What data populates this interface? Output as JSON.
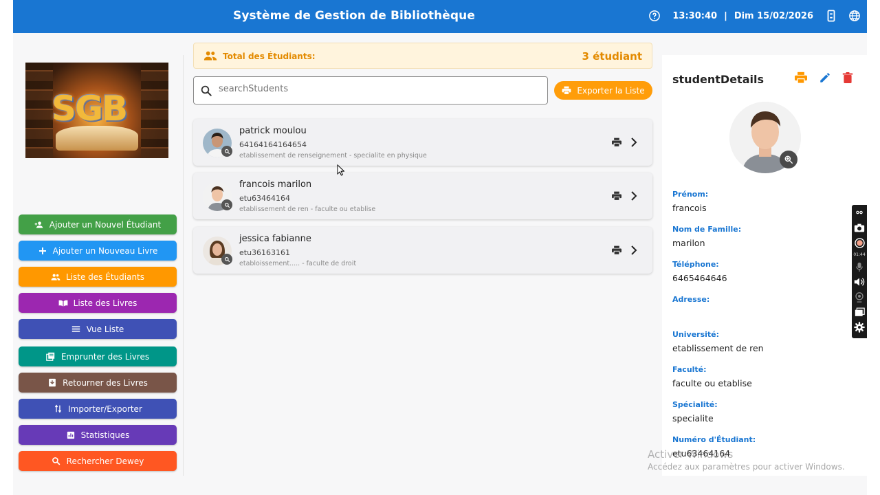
{
  "header": {
    "title": "Système de Gestion de Bibliothèque",
    "time": "13:30:40",
    "separator": "|",
    "date": "Dim 15/02/2026"
  },
  "sidebar": {
    "logo_text": "SGB",
    "buttons": [
      {
        "label": "Ajouter un Nouvel Étudiant",
        "color": "#43a047",
        "icon": "person-add-icon"
      },
      {
        "label": "Ajouter un Nouveau Livre",
        "color": "#2196f3",
        "icon": "plus-icon"
      },
      {
        "label": "Liste des Étudiants",
        "color": "#ff9800",
        "icon": "group-icon"
      },
      {
        "label": "Liste des Livres",
        "color": "#9c27b0",
        "icon": "book-open-icon"
      },
      {
        "label": "Vue Liste",
        "color": "#3f51b5",
        "icon": "list-icon"
      },
      {
        "label": "Emprunter des Livres",
        "color": "#009688",
        "icon": "library-icon"
      },
      {
        "label": "Retourner des Livres",
        "color": "#795548",
        "icon": "return-icon"
      },
      {
        "label": "Importer/Exporter",
        "color": "#3f51b5",
        "icon": "import-export-icon"
      },
      {
        "label": "Statistiques",
        "color": "#673ab7",
        "icon": "chart-icon"
      },
      {
        "label": "Rechercher Dewey",
        "color": "#ff5722",
        "icon": "search-icon"
      }
    ]
  },
  "main": {
    "total_label": "Total des Étudiants:",
    "total_count": "3 étudiant",
    "search_placeholder": "searchStudents",
    "export_label": "Exporter la Liste",
    "students": [
      {
        "name": "patrick moulou",
        "number": "64164164164654",
        "meta": "etablissement de renseignement - specialite en physique"
      },
      {
        "name": "francois marilon",
        "number": "etu63464164",
        "meta": "etablissement de ren - faculte ou etablise"
      },
      {
        "name": "jessica fabianne",
        "number": "etu36163161",
        "meta": "etabloissement..... - faculte de droit"
      }
    ]
  },
  "details": {
    "title": "studentDetails",
    "fields": [
      {
        "label": "Prénom:",
        "value": "francois"
      },
      {
        "label": "Nom de Famille:",
        "value": "marilon"
      },
      {
        "label": "Téléphone:",
        "value": "6465464646"
      },
      {
        "label": "Adresse:",
        "value": ""
      },
      {
        "label": "Université:",
        "value": "etablissement de ren"
      },
      {
        "label": "Faculté:",
        "value": "faculte ou etablise"
      },
      {
        "label": "Spécialité:",
        "value": "specialite"
      },
      {
        "label": "Numéro d'Étudiant:",
        "value": "etu63464164"
      }
    ]
  },
  "recorder": {
    "time": "01:44"
  },
  "watermark": {
    "line1": "Activer Windows",
    "line2": "Accédez aux paramètres pour activer Windows."
  },
  "colors": {
    "accent": "#1976d2",
    "orange": "#ff9d0a",
    "danger": "#e53935"
  }
}
